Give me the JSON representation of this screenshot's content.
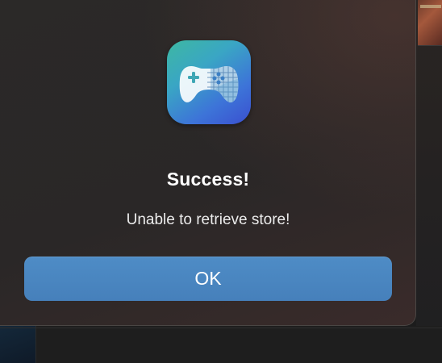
{
  "dialog": {
    "title": "Success!",
    "message": "Unable to retrieve store!",
    "ok_label": "OK",
    "icon": "gamepad-icon"
  },
  "colors": {
    "button": "#4a86c1",
    "dialog_background": "#2a2727",
    "text": "#ffffff"
  }
}
